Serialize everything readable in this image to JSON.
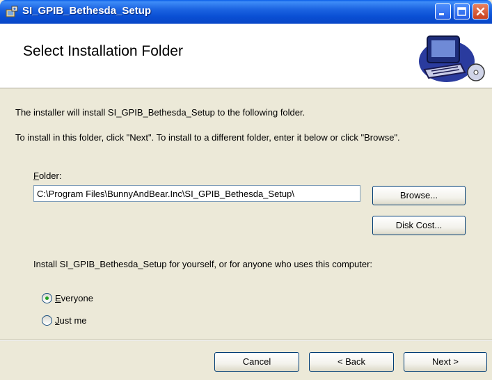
{
  "window": {
    "title": "SI_GPIB_Bethesda_Setup",
    "colors": {
      "titlebar": "#0a4fd4",
      "close_button": "#c9401e",
      "dialog_bg": "#ece9d8"
    }
  },
  "banner": {
    "title": "Select Installation Folder",
    "art_icon": "computer-disc-icon"
  },
  "body": {
    "line1": "The installer will install SI_GPIB_Bethesda_Setup to the following folder.",
    "line2": "To install in this folder, click \"Next\". To install to a different folder, enter it below or click \"Browse\".",
    "folder_label_rest": "older:",
    "folder_label_hotkey": "F",
    "folder_value": "C:\\Program Files\\BunnyAndBear.Inc\\SI_GPIB_Bethesda_Setup\\",
    "browse_label": "Browse...",
    "disk_cost_label": "Disk Cost...",
    "install_for_prompt": "Install SI_GPIB_Bethesda_Setup for yourself, or for anyone who uses this computer:",
    "options": [
      {
        "hotkey": "E",
        "rest": "veryone",
        "selected": true
      },
      {
        "hotkey": "J",
        "rest": "ust me",
        "selected": false
      }
    ]
  },
  "footer": {
    "cancel_label": "Cancel",
    "back_label": "< Back",
    "next_label": "Next >"
  }
}
